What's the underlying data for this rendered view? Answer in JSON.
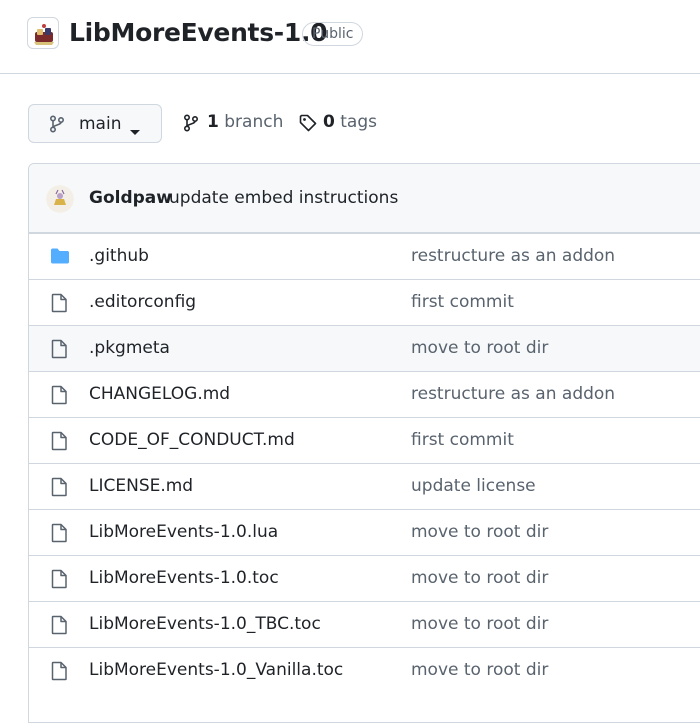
{
  "repo": {
    "name": "LibMoreEvents-1.0",
    "visibility": "Public"
  },
  "branch": {
    "current": "main",
    "branch_count": "1",
    "branch_label": "branch",
    "tag_count": "0",
    "tag_label": "tags"
  },
  "commit": {
    "author": "Goldpaw",
    "message": "update embed instructions"
  },
  "files": [
    {
      "type": "folder",
      "icon": "folder-icon",
      "name": ".github",
      "message": "restructure as an addon"
    },
    {
      "type": "file",
      "icon": "file-icon",
      "name": ".editorconfig",
      "message": "first commit"
    },
    {
      "type": "file",
      "icon": "file-icon",
      "name": ".pkgmeta",
      "message": "move to root dir"
    },
    {
      "type": "file",
      "icon": "file-icon",
      "name": "CHANGELOG.md",
      "message": "restructure as an addon"
    },
    {
      "type": "file",
      "icon": "file-icon",
      "name": "CODE_OF_CONDUCT.md",
      "message": "first commit"
    },
    {
      "type": "file",
      "icon": "file-icon",
      "name": "LICENSE.md",
      "message": "update license"
    },
    {
      "type": "file",
      "icon": "file-icon",
      "name": "LibMoreEvents-1.0.lua",
      "message": "move to root dir"
    },
    {
      "type": "file",
      "icon": "file-icon",
      "name": "LibMoreEvents-1.0.toc",
      "message": "move to root dir"
    },
    {
      "type": "file",
      "icon": "file-icon",
      "name": "LibMoreEvents-1.0_TBC.toc",
      "message": "move to root dir"
    },
    {
      "type": "file",
      "icon": "file-icon",
      "name": "LibMoreEvents-1.0_Vanilla.toc",
      "message": "move to root dir"
    }
  ],
  "colors": {
    "folder": "#54aeff",
    "border": "#d0d7de",
    "muted_text": "#59636e"
  }
}
